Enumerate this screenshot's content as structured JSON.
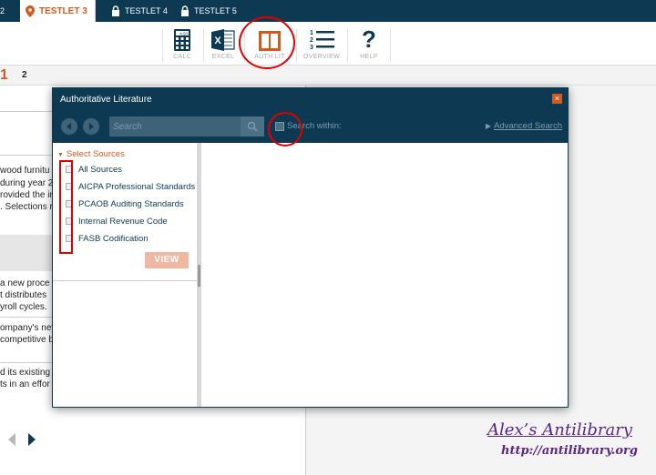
{
  "tabs": {
    "prev_fragment": "2",
    "active": "TESTLET 3",
    "locked": [
      "TESTLET 4",
      "TESTLET 5"
    ]
  },
  "toolbar": {
    "calc": "CALC",
    "excel": "EXCEL",
    "auth_lit": "AUTH LIT",
    "overview": "OVERVIEW",
    "help": "HELP",
    "calc_display": "4.93",
    "excel_glyph": "X",
    "help_glyph": "?",
    "overview_digits": [
      "1",
      "2",
      "3"
    ]
  },
  "question_strip": {
    "current": "1",
    "next": "2"
  },
  "background": {
    "lines_a": [
      "wood furnitu",
      "during year 2",
      "rovided the in",
      ". Selections r"
    ],
    "lines_b": [
      "a new proce",
      "t distributes",
      "yroll cycles."
    ],
    "lines_c": [
      "ompany's nev",
      "competitive b"
    ],
    "lines_d": [
      "d its existing",
      "ts in an effor"
    ]
  },
  "modal": {
    "title": "Authoritative Literature",
    "close": "×",
    "search_placeholder": "Search",
    "search_within": "Search within:",
    "advanced_search": "Advanced Search",
    "select_sources": "Select Sources",
    "sources": [
      "All Sources",
      "AICPA Professional Standards",
      "PCAOB Auditing Standards",
      "Internal Revenue Code",
      "FASB Codification"
    ],
    "view_button": "VIEW"
  },
  "watermark": {
    "title": "Alex’s Antilibrary",
    "url": "http://antilibrary.org"
  },
  "colors": {
    "navy": "#0d3a52",
    "orange": "#d35a1f",
    "annotation_red": "#e00000",
    "watermark_purple": "#5a2785"
  }
}
